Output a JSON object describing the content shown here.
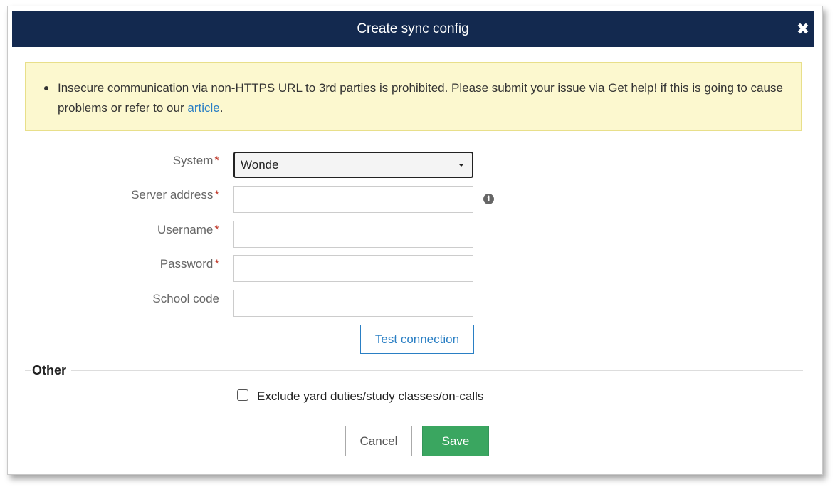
{
  "dialog": {
    "title": "Create sync config",
    "close_icon": "close-icon"
  },
  "alert": {
    "message_before": "Insecure communication via non-HTTPS URL to 3rd parties is prohibited. Please submit your issue via Get help! if this is going to cause problems or refer to our ",
    "link_text": "article",
    "message_after": "."
  },
  "form": {
    "system": {
      "label": "System",
      "required_mark": "*",
      "value": "Wonde"
    },
    "server_address": {
      "label": "Server address",
      "required_mark": "*",
      "value": "",
      "info_icon": "info-icon",
      "info_glyph": "i"
    },
    "username": {
      "label": "Username",
      "required_mark": "*",
      "value": ""
    },
    "password": {
      "label": "Password",
      "required_mark": "*",
      "value": ""
    },
    "school_code": {
      "label": "School code",
      "value": ""
    },
    "test_connection_label": "Test connection"
  },
  "other": {
    "legend": "Other",
    "exclude_checkbox": {
      "label": "Exclude yard duties/study classes/on-calls",
      "checked": false
    }
  },
  "footer": {
    "cancel_label": "Cancel",
    "save_label": "Save"
  },
  "colors": {
    "header_bg": "#13294f",
    "alert_bg": "#fcf8cf",
    "link": "#2a7fc4",
    "save_bg": "#3aa660",
    "required": "#c0392b"
  }
}
